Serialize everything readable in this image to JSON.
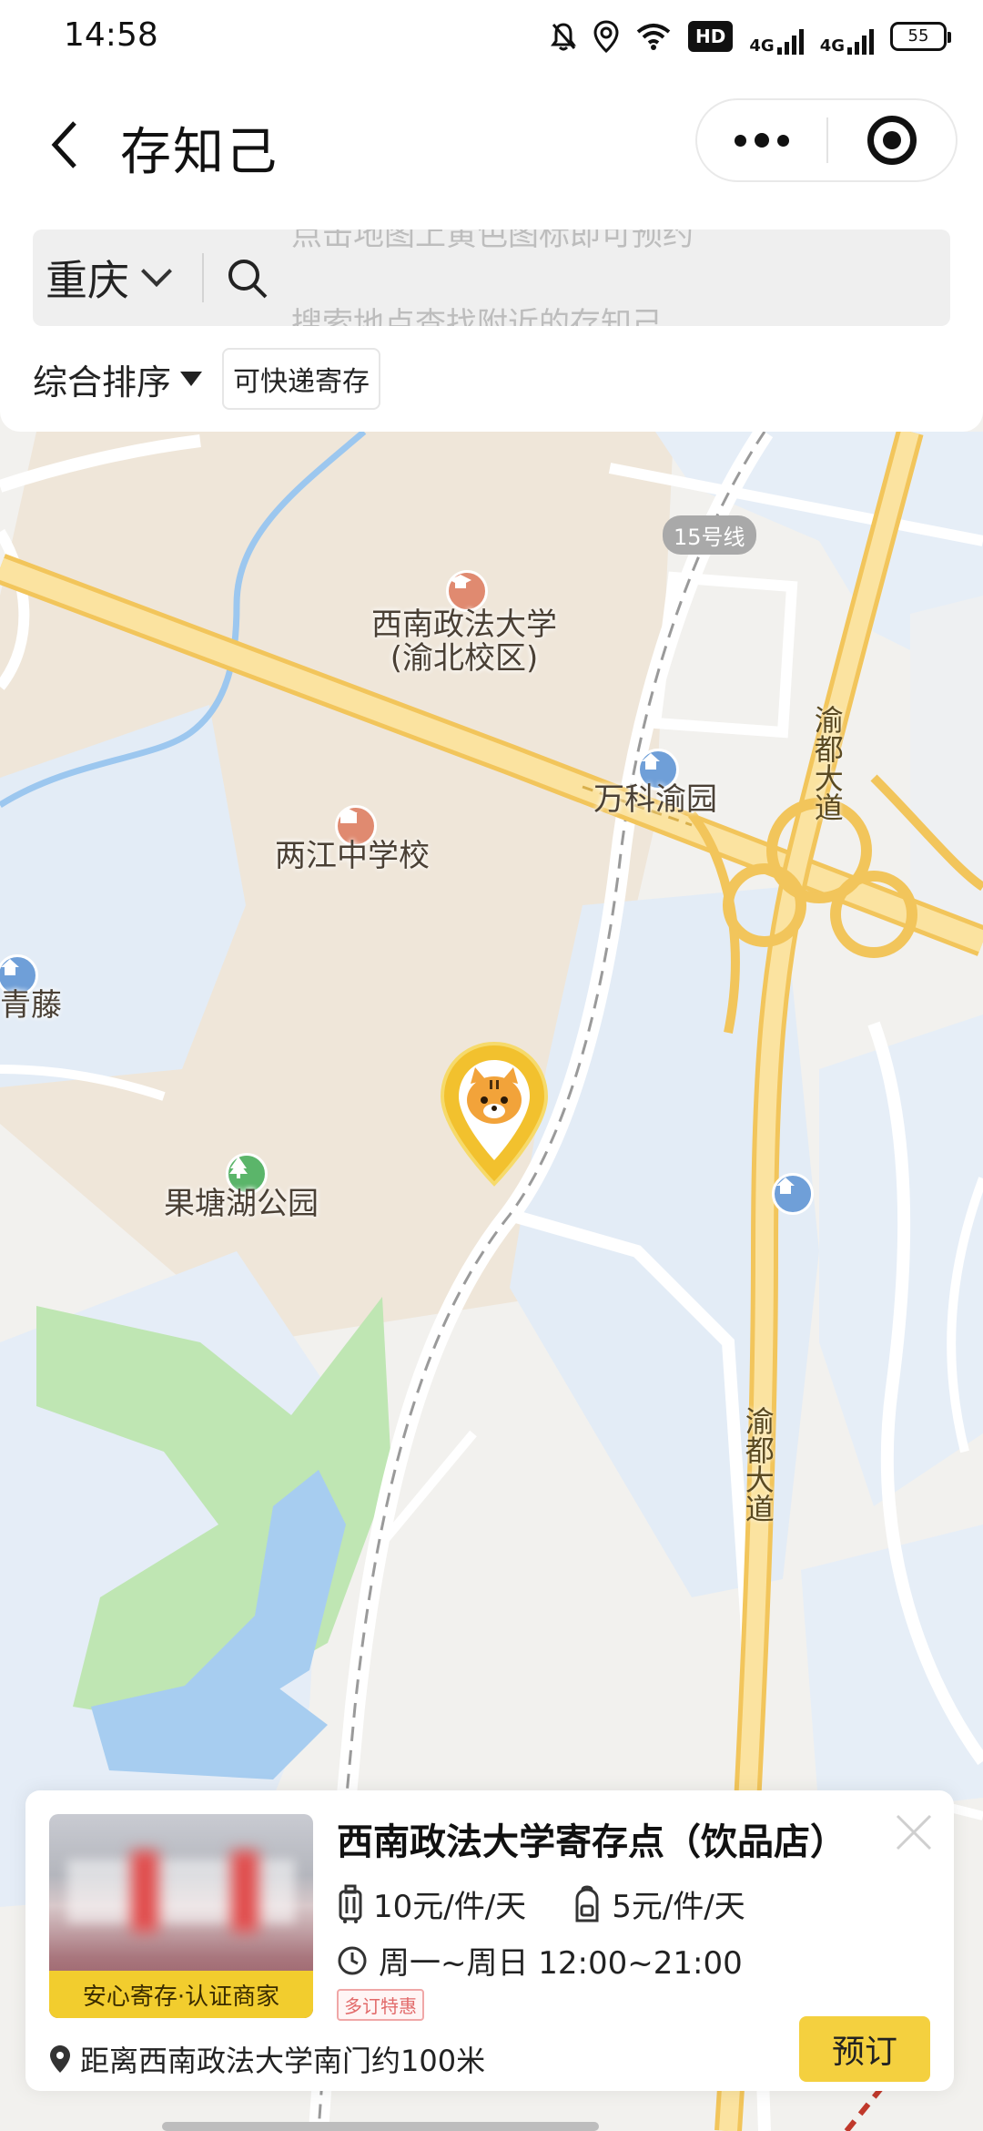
{
  "status_bar": {
    "time": "14:58",
    "hd_label": "HD",
    "net1": "4G",
    "net2": "4G",
    "battery": "55"
  },
  "nav": {
    "title": "存知己"
  },
  "search": {
    "city": "重庆",
    "hint_prev": "点击地图上黄色图标即可预约",
    "hint_current": "搜索地点查找附近的存知己"
  },
  "filters": {
    "sort_label": "综合排序",
    "tag_label": "可快递寄存"
  },
  "map": {
    "line_label": "15号线",
    "road_label_1": "渝都大道",
    "road_label_2": "渝都大道",
    "poi_university_line1": "西南政法大学",
    "poi_university_line2": "(渝北校区)",
    "poi_school": "两江中学校",
    "poi_residence": "万科渝园",
    "poi_left": "青藤",
    "poi_park": "果塘湖公园",
    "colors": {
      "background": "#f2f1ee",
      "water": "#e3ecf6",
      "green": "#bfe6b3",
      "highway": "#f7d57a",
      "accent": "#f2cd2e"
    }
  },
  "card": {
    "title": "西南政法大学寄存点（饮品店）",
    "badge": "安心寄存·认证商家",
    "price_luggage": "10元/件/天",
    "price_bag": "5元/件/天",
    "hours": "周一~周日 12:00~21:00",
    "promo": "多订特惠",
    "distance": "距离西南政法大学南门约100米",
    "book_label": "预订"
  }
}
